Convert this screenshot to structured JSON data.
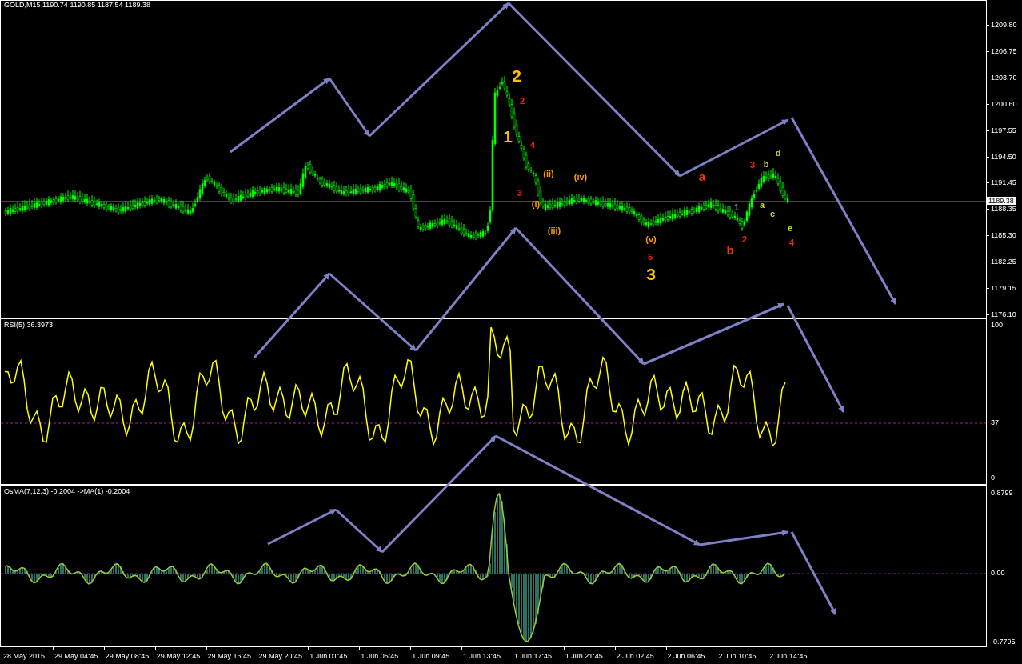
{
  "header": {
    "title": "GOLD,M15  1190.74 1190.85 1187.54 1189.38"
  },
  "price_axis": {
    "ticks": [
      "1209.80",
      "1206.75",
      "1203.70",
      "1200.60",
      "1197.55",
      "1194.50",
      "1191.45",
      "1188.35",
      "1185.30",
      "1182.25",
      "1179.15",
      "1176.10"
    ],
    "current": "1189.38"
  },
  "rsi": {
    "title": "RSI(5) 36.3973",
    "ticks": [
      "100",
      "37",
      "0"
    ]
  },
  "osma": {
    "title": "OsMA(7,12,3) -0.2004  ->MA(1) -0.2004",
    "ticks": [
      "0.8799",
      "0.00",
      "-0.7795"
    ]
  },
  "time_axis": [
    "28 May 2015",
    "29 May 04:45",
    "29 May 08:45",
    "29 May 12:45",
    "29 May 16:45",
    "29 May 20:45",
    "1 Jun 01:45",
    "1 Jun 05:45",
    "1 Jun 09:45",
    "1 Jun 13:45",
    "1 Jun 17:45",
    "1 Jun 21:45",
    "2 Jun 02:45",
    "2 Jun 06:45",
    "2 Jun 10:45",
    "2 Jun 14:45"
  ],
  "wave_labels": [
    {
      "text": "2",
      "kind": "major",
      "color": "#ffc000"
    },
    {
      "text": "1",
      "kind": "major",
      "color": "#ffc000"
    },
    {
      "text": "2",
      "kind": "minor",
      "color": "#ff1a1a"
    },
    {
      "text": "4",
      "kind": "minor",
      "color": "#ff1a1a"
    },
    {
      "text": "3",
      "kind": "minor",
      "color": "#ff1a1a"
    },
    {
      "text": "(ii)",
      "kind": "minor",
      "color": "#ff9900"
    },
    {
      "text": "(iv)",
      "kind": "minor",
      "color": "#ff9900"
    },
    {
      "text": "(i)",
      "kind": "minor",
      "color": "#ff9900"
    },
    {
      "text": "(iii)",
      "kind": "minor",
      "color": "#ff9900"
    },
    {
      "text": "(v)",
      "kind": "minor",
      "color": "#ff9900"
    },
    {
      "text": "5",
      "kind": "minor",
      "color": "#ff1a1a"
    },
    {
      "text": "3",
      "kind": "major",
      "color": "#ffc000"
    },
    {
      "text": "a",
      "kind": "medium",
      "color": "#ff3300"
    },
    {
      "text": "b",
      "kind": "medium",
      "color": "#ff3300"
    },
    {
      "text": "3",
      "kind": "minor",
      "color": "#ff1a1a"
    },
    {
      "text": "b",
      "kind": "minor",
      "color": "#c8d830"
    },
    {
      "text": "d",
      "kind": "minor",
      "color": "#c8d830"
    },
    {
      "text": "a",
      "kind": "minor",
      "color": "#c8d830"
    },
    {
      "text": "c",
      "kind": "minor",
      "color": "#c8d830"
    },
    {
      "text": "1",
      "kind": "minor",
      "color": "#888888"
    },
    {
      "text": "2",
      "kind": "minor",
      "color": "#ff1a1a"
    },
    {
      "text": "e",
      "kind": "minor",
      "color": "#c8d830"
    },
    {
      "text": "4",
      "kind": "minor",
      "color": "#ff1a1a"
    }
  ]
}
